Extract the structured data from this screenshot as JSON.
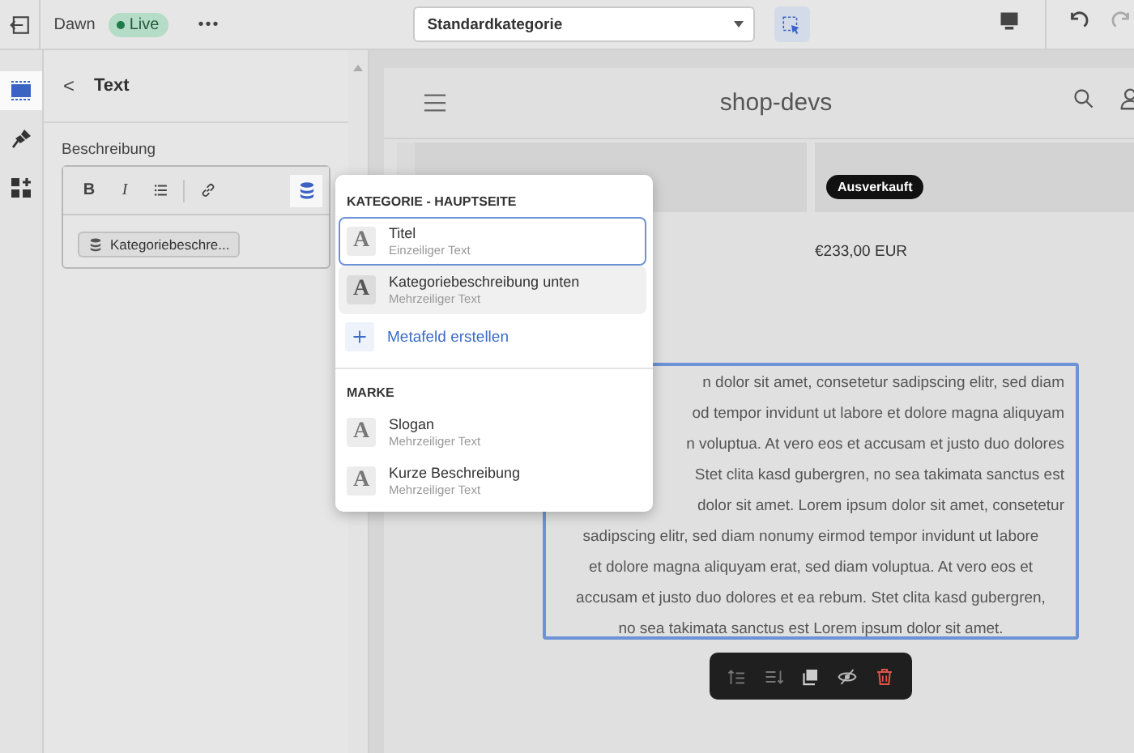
{
  "topbar": {
    "theme_name": "Dawn",
    "status": "Live",
    "more": "•••",
    "template_select": {
      "value": "Standardkategorie"
    },
    "inspect_selected": true
  },
  "rail": [
    {
      "kind": "sections",
      "selected": true
    },
    {
      "kind": "theme",
      "selected": false
    },
    {
      "kind": "apps",
      "selected": false
    }
  ],
  "panel": {
    "back": "<",
    "title": "Text",
    "field_label": "Beschreibung",
    "toolbar": [
      {
        "kind": "bold",
        "label": "B",
        "selected": false
      },
      {
        "kind": "italic",
        "label": "I",
        "selected": false
      },
      {
        "kind": "list",
        "selected": false
      },
      {
        "kind": "link",
        "selected": false
      },
      {
        "kind": "source",
        "selected": true
      }
    ],
    "chip": "Kategoriebeschre..."
  },
  "preview": {
    "store_name": "shop-devs",
    "badge": "Ausverkauft",
    "price": "€233,00 EUR",
    "paragraph_lines": [
      {
        "text": "n dolor sit amet, consetetur sadipscing elitr, sed diam",
        "partly_hidden": true
      },
      {
        "text": "od tempor invidunt ut labore et dolore magna aliquyam",
        "partly_hidden": true
      },
      {
        "text": "n voluptua. At vero eos et accusam et justo duo dolores",
        "partly_hidden": true
      },
      {
        "text": "Stet clita kasd gubergren, no sea takimata sanctus est",
        "partly_hidden": true
      },
      {
        "text": "dolor sit amet. Lorem ipsum dolor sit amet, consetetur",
        "partly_hidden": true
      },
      {
        "text": "sadipscing elitr, sed diam nonumy eirmod tempor invidunt ut labore",
        "partly_hidden": false
      },
      {
        "text": "et dolore magna aliquyam erat, sed diam voluptua. At vero eos et",
        "partly_hidden": false
      },
      {
        "text": "accusam et justo duo dolores et ea rebum. Stet clita kasd gubergren,",
        "partly_hidden": false
      },
      {
        "text": "no sea takimata sanctus est Lorem ipsum dolor sit amet.",
        "partly_hidden": false
      }
    ]
  },
  "popover": {
    "groups": [
      {
        "heading": "KATEGORIE - HAUPTSEITE",
        "items": [
          {
            "icon": "A",
            "title": "Titel",
            "subtitle": "Einzeiliger Text",
            "selected": true,
            "highlighted": false
          },
          {
            "icon": "A",
            "title": "Kategoriebeschreibung unten",
            "subtitle": "Mehrzeiliger Text",
            "selected": false,
            "highlighted": true
          }
        ],
        "action": "Metafeld erstellen"
      },
      {
        "heading": "MARKE",
        "items": [
          {
            "icon": "A",
            "title": "Slogan",
            "subtitle": "Mehrzeiliger Text",
            "selected": false,
            "highlighted": false
          },
          {
            "icon": "A",
            "title": "Kurze Beschreibung",
            "subtitle": "Mehrzeiliger Text",
            "selected": false,
            "highlighted": false
          }
        ]
      }
    ]
  }
}
